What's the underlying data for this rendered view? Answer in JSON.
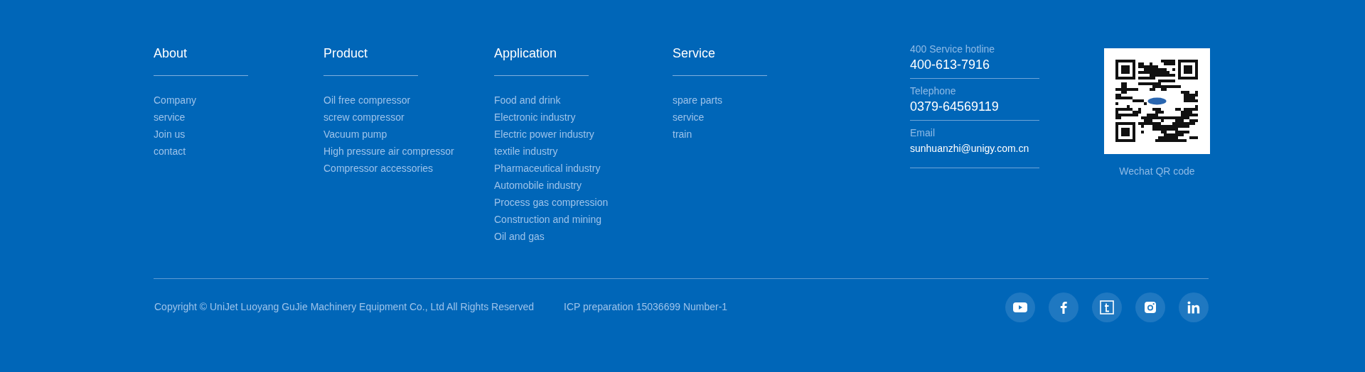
{
  "columns": [
    {
      "heading": "About",
      "links": [
        "Company",
        "service",
        "Join us",
        "contact"
      ]
    },
    {
      "heading": "Product",
      "links": [
        "Oil free compressor",
        "screw compressor",
        "Vacuum pump",
        "High pressure air compressor",
        "Compressor accessories"
      ]
    },
    {
      "heading": "Application",
      "links": [
        "Food and drink",
        "Electronic industry",
        "Electric power industry",
        "textile industry",
        "Pharmaceutical industry",
        "Automobile industry",
        "Process gas compression",
        "Construction and mining",
        "Oil and gas"
      ]
    },
    {
      "heading": "Service",
      "links": [
        "spare parts",
        "service",
        "train"
      ]
    }
  ],
  "contact": [
    {
      "kind": "phone",
      "label": "400 Service hotline",
      "value": "400-613-7916"
    },
    {
      "kind": "phone",
      "label": "Telephone",
      "value": "0379-64569119"
    },
    {
      "kind": "email",
      "label": "Email",
      "value": "sunhuanzhi@unigy.com.cn"
    }
  ],
  "qr": {
    "caption": "Wechat QR code"
  },
  "copyright": "Copyright © UniJet Luoyang GuJie Machinery Equipment Co., Ltd All Rights Reserved",
  "icp": "ICP preparation 15036699 Number-1"
}
